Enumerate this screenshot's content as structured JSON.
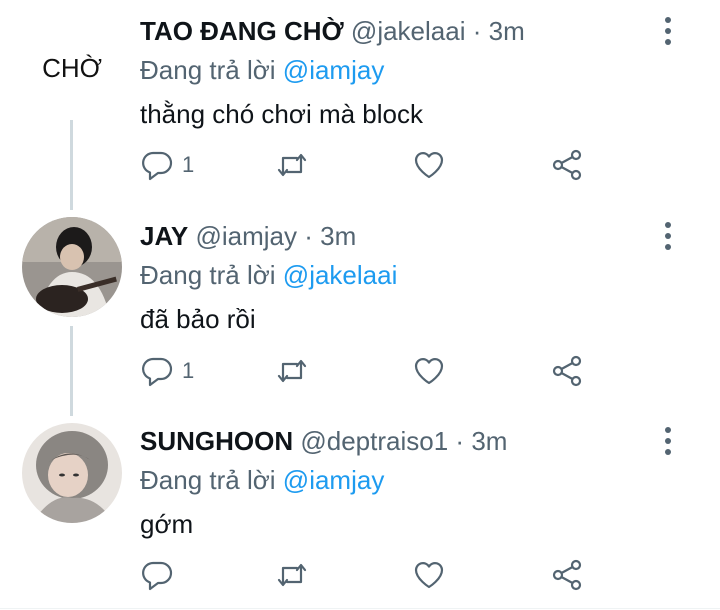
{
  "tweets": [
    {
      "avatar_text": "CHỜ",
      "name": "TAO ĐANG CHỜ",
      "handle": "@jakelaai",
      "separator": "·",
      "time": "3m",
      "reply_prefix": "Đang trả lời",
      "reply_to": "@iamjay",
      "text": "thằng chó chơi mà block",
      "reply_count": "1"
    },
    {
      "name": "JAY",
      "handle": "@iamjay",
      "separator": "·",
      "time": "3m",
      "reply_prefix": "Đang trả lời",
      "reply_to": "@jakelaai",
      "text": "đã bảo rồi",
      "reply_count": "1"
    },
    {
      "name": "SUNGHOON",
      "handle": "@deptraiso1",
      "separator": "·",
      "time": "3m",
      "reply_prefix": "Đang trả lời",
      "reply_to": "@iamjay",
      "text": "gớm",
      "reply_count": ""
    }
  ],
  "colors": {
    "accent": "#1d9bf0",
    "muted": "#536471",
    "text": "#0f1419",
    "thread_line": "#cfd9de"
  },
  "icons": [
    "reply-icon",
    "retweet-icon",
    "like-icon",
    "share-icon",
    "more-icon"
  ]
}
